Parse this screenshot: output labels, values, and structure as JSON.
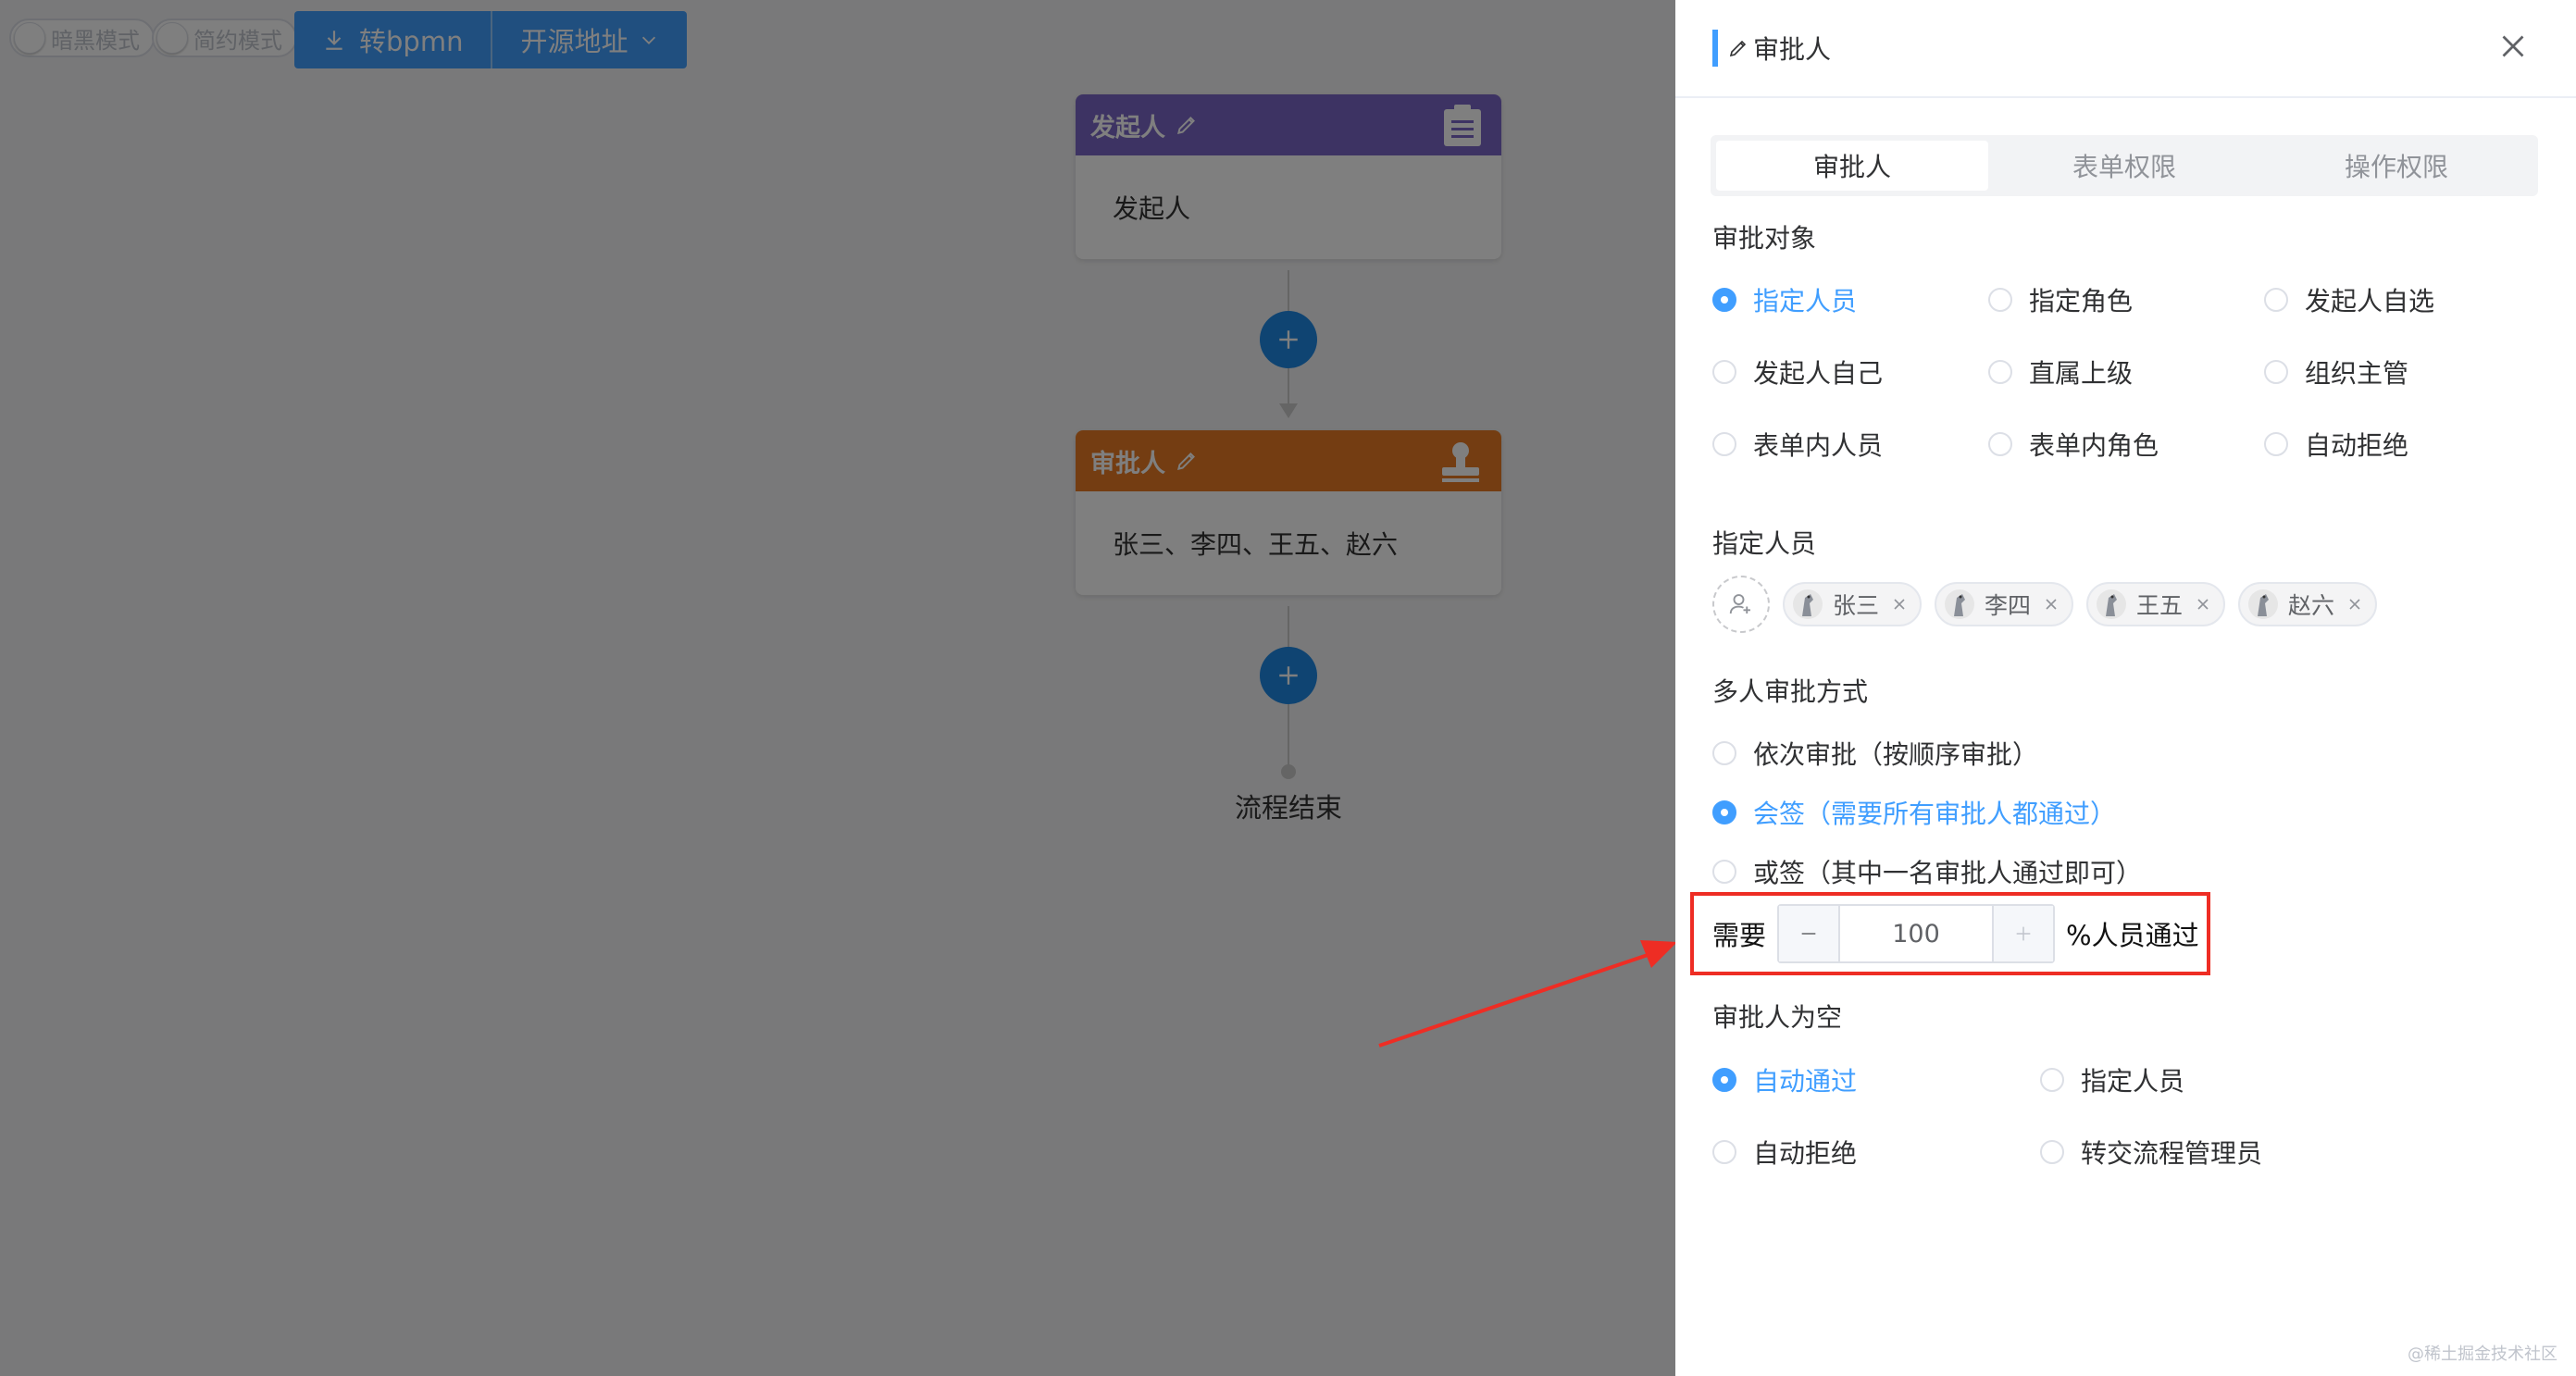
{
  "toolbar": {
    "dark_mode_label": "暗黑模式",
    "simple_mode_label": "简约模式",
    "export_bpmn_label": "转bpmn",
    "source_label": "开源地址"
  },
  "flow": {
    "start_node": {
      "title": "发起人",
      "body": "发起人",
      "color": "#7a67c7"
    },
    "approver_node": {
      "title": "审批人",
      "body": "张三、李四、王五、赵六",
      "color": "#e87b24"
    },
    "end_label": "流程结束"
  },
  "drawer": {
    "title": "审批人",
    "tabs": [
      {
        "label": "审批人",
        "active": true
      },
      {
        "label": "表单权限",
        "active": false
      },
      {
        "label": "操作权限",
        "active": false
      }
    ],
    "approval_target": {
      "label": "审批对象",
      "options": [
        {
          "label": "指定人员",
          "checked": true
        },
        {
          "label": "指定角色",
          "checked": false
        },
        {
          "label": "发起人自选",
          "checked": false
        },
        {
          "label": "发起人自己",
          "checked": false
        },
        {
          "label": "直属上级",
          "checked": false
        },
        {
          "label": "组织主管",
          "checked": false
        },
        {
          "label": "表单内人员",
          "checked": false
        },
        {
          "label": "表单内角色",
          "checked": false
        },
        {
          "label": "自动拒绝",
          "checked": false
        }
      ]
    },
    "assigned_people": {
      "label": "指定人员",
      "people": [
        "张三",
        "李四",
        "王五",
        "赵六"
      ]
    },
    "multi_mode": {
      "label": "多人审批方式",
      "options": [
        {
          "label": "依次审批（按顺序审批）",
          "checked": false
        },
        {
          "label": "会签（需要所有审批人都通过）",
          "checked": true
        },
        {
          "label": "或签（其中一名审批人通过即可）",
          "checked": false
        }
      ],
      "need_prefix": "需要",
      "percent_value": "100",
      "need_suffix": "%人员通过"
    },
    "empty_approver": {
      "label": "审批人为空",
      "options": [
        {
          "label": "自动通过",
          "checked": true
        },
        {
          "label": "指定人员",
          "checked": false
        },
        {
          "label": "自动拒绝",
          "checked": false
        },
        {
          "label": "转交流程管理员",
          "checked": false
        }
      ]
    }
  },
  "watermark": "@稀土掘金技术社区",
  "colors": {
    "accent": "#409eff",
    "highlight_box": "#ee2d24",
    "add_button": "#1e88e5"
  }
}
